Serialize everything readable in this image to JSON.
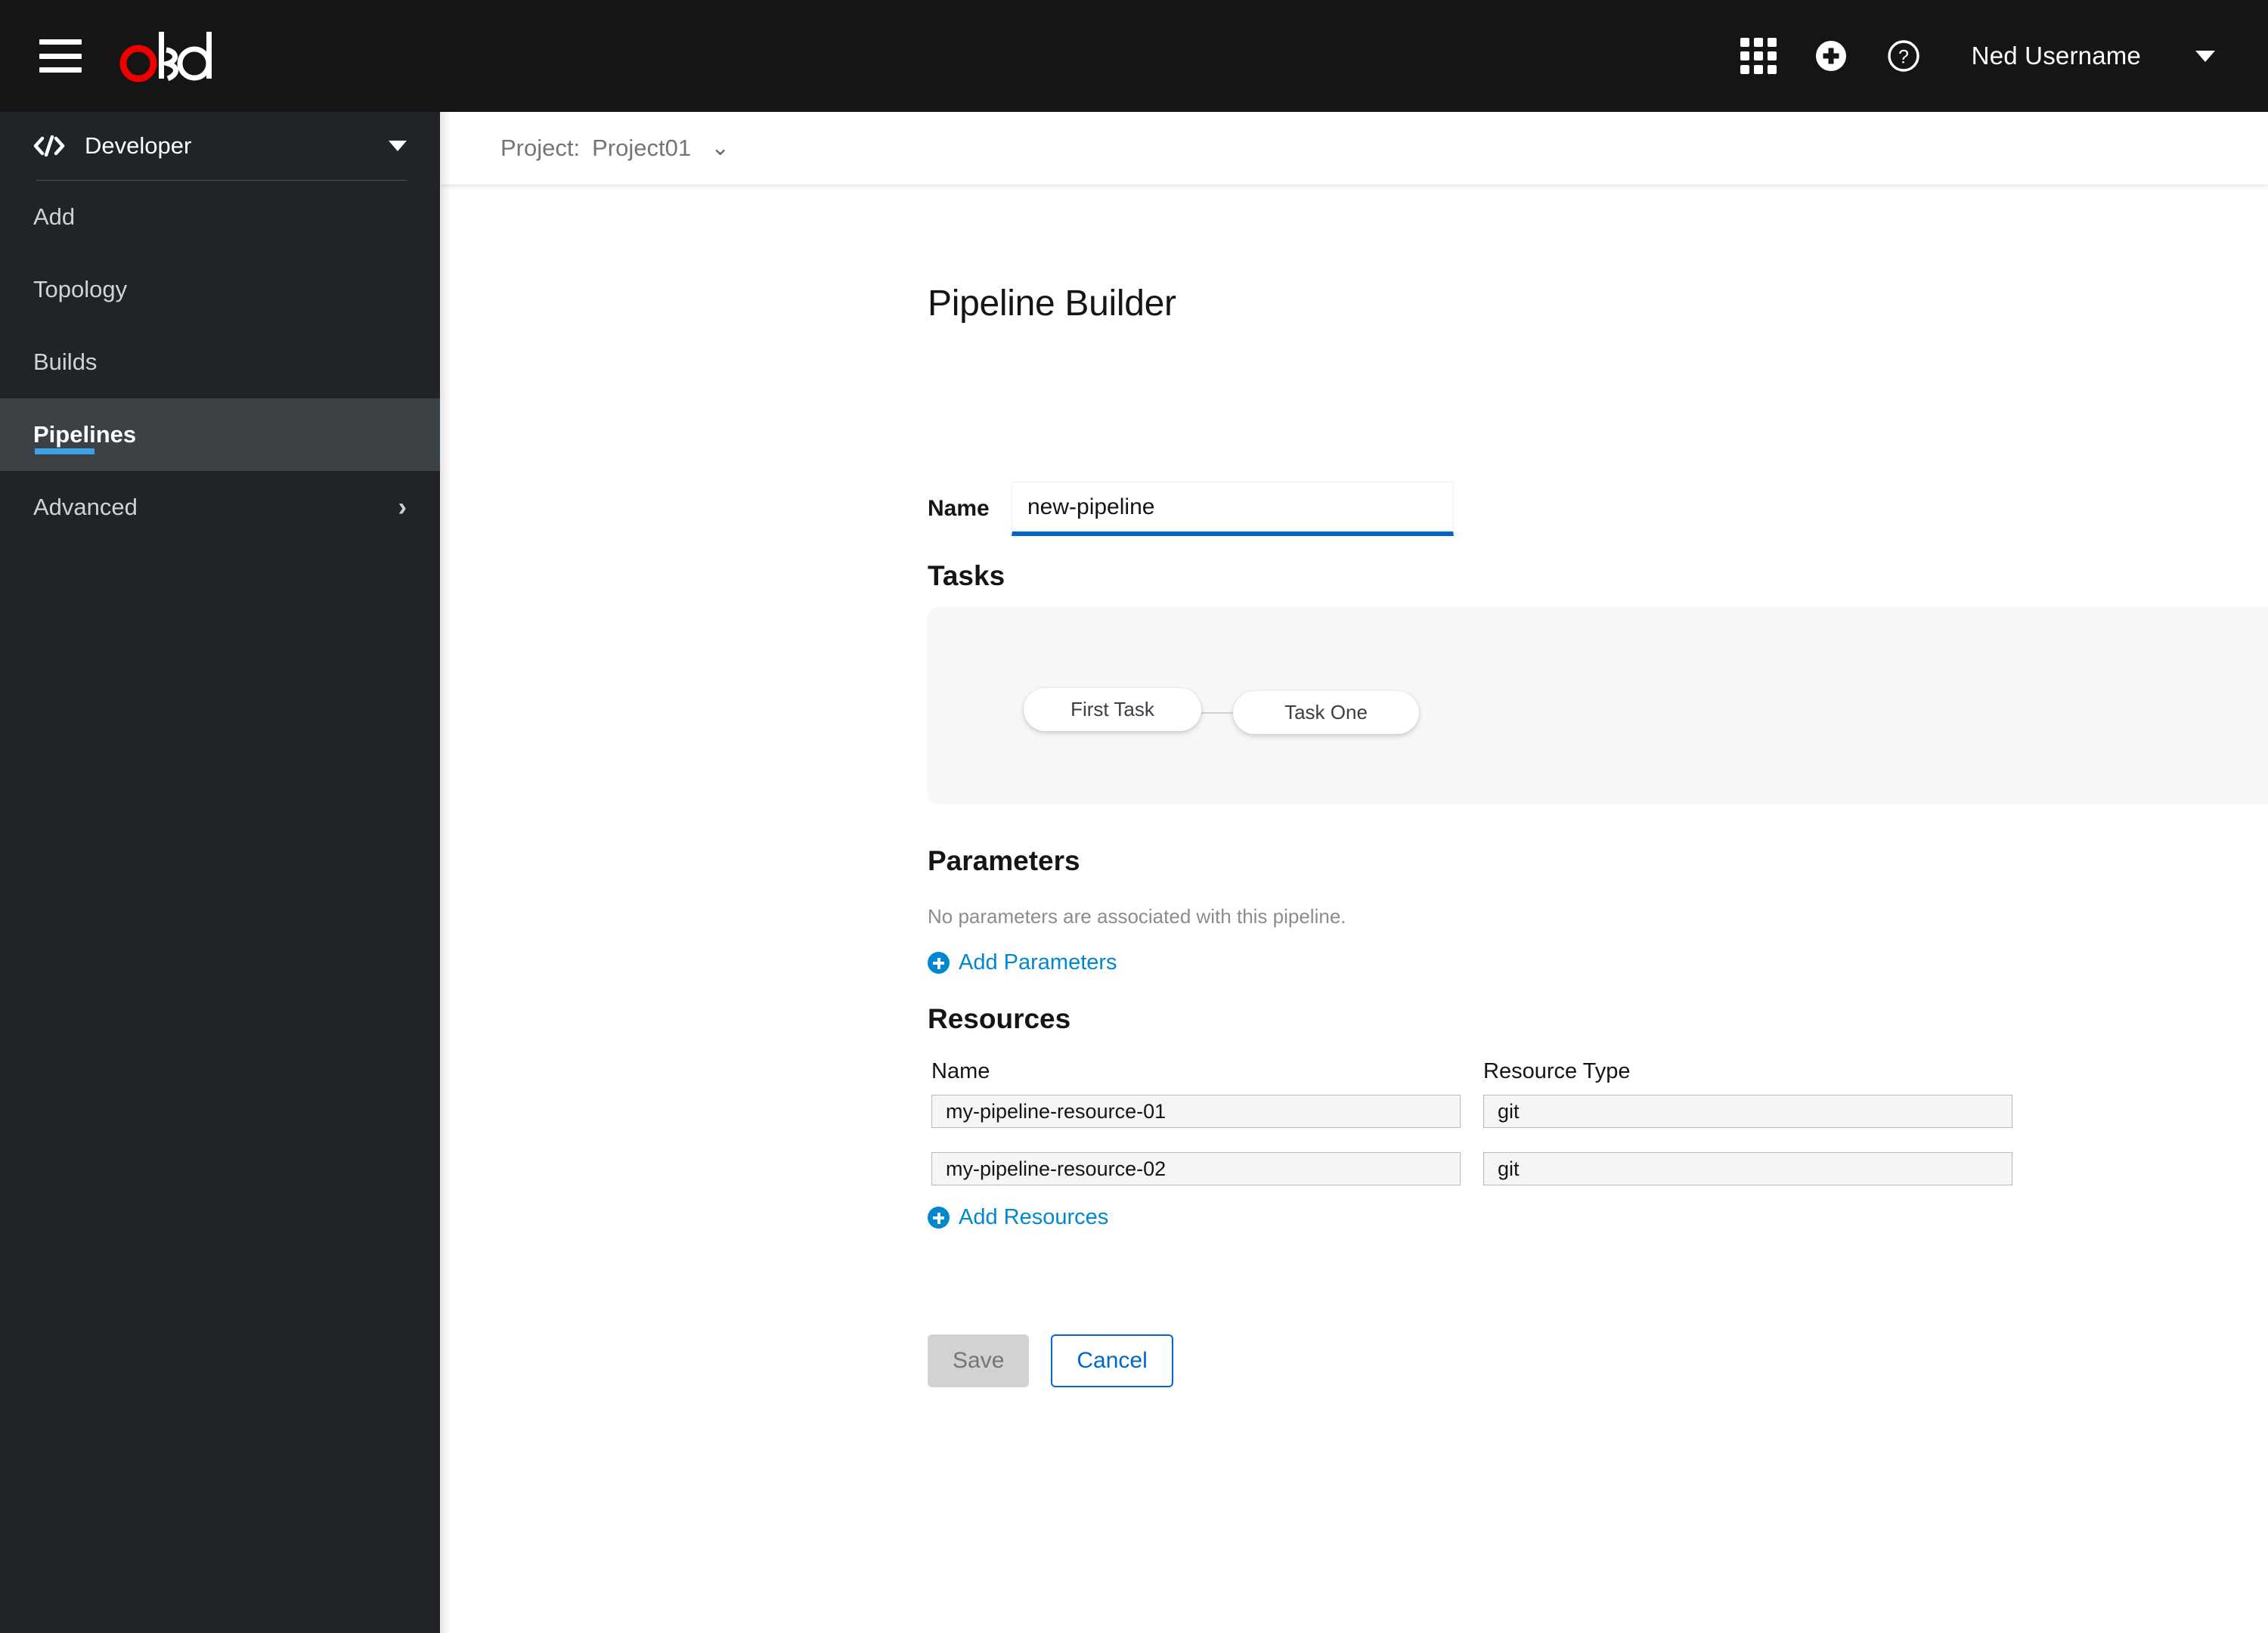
{
  "masthead": {
    "menu_icon": "hamburger-icon",
    "brand": "okd",
    "brand_accent_color": "#ee0000",
    "apps_icon": "grid-icon",
    "add_icon": "plus-circle-icon",
    "help_icon": "question-circle-icon",
    "username": "Ned Username",
    "user_caret_icon": "caret-down-icon",
    "background": "#151515"
  },
  "sidebar": {
    "perspective": {
      "icon": "code-icon",
      "label": "Developer",
      "caret_icon": "caret-down-icon"
    },
    "items": [
      {
        "label": "Add",
        "active": false
      },
      {
        "label": "Topology",
        "active": false
      },
      {
        "label": "Builds",
        "active": false
      },
      {
        "label": "Pipelines",
        "active": true
      },
      {
        "label": "Advanced",
        "active": false,
        "chevron_icon": "chevron-right-icon"
      }
    ],
    "active_color": "#3ea1e8",
    "background": "#212427"
  },
  "project_bar": {
    "label": "Project:",
    "value": "Project01",
    "caret_icon": "chevron-down-icon"
  },
  "page": {
    "title": "Pipeline Builder"
  },
  "name_field": {
    "label": "Name",
    "value": "new-pipeline",
    "placeholder": "Name",
    "focus_color": "#0066cc"
  },
  "tasks": {
    "heading": "Tasks",
    "nodes": [
      {
        "label": "First Task"
      },
      {
        "label": "Task One"
      }
    ]
  },
  "parameters": {
    "heading": "Parameters",
    "empty_message": "No parameters are associated with this pipeline.",
    "add_label": "Add Parameters",
    "add_icon": "plus-circle-icon",
    "link_color": "#0088ce"
  },
  "resources": {
    "heading": "Resources",
    "columns": [
      "Name",
      "Resource Type"
    ],
    "rows": [
      {
        "name": "my-pipeline-resource-01",
        "type": "git"
      },
      {
        "name": "my-pipeline-resource-02",
        "type": "git"
      }
    ],
    "add_label": "Add Resources",
    "add_icon": "plus-circle-icon"
  },
  "footer": {
    "save_label": "Save",
    "save_disabled": true,
    "cancel_label": "Cancel",
    "primary_color": "#0066cc"
  }
}
